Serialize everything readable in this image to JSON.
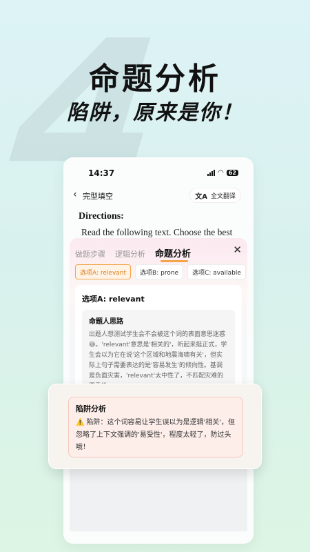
{
  "hero": {
    "background_number": "4",
    "title": "命题分析",
    "subtitle": "陷阱，原来是你！"
  },
  "status_bar": {
    "time": "14:37",
    "battery": "62"
  },
  "nav": {
    "title": "完型填空",
    "translate_label": "全文翻译",
    "translate_icon": "translate-icon"
  },
  "passage": {
    "directions": "Directions:",
    "text": "Read the following text. Choose the best"
  },
  "sheet": {
    "tabs": [
      {
        "label": "做题步骤",
        "active": false
      },
      {
        "label": "逻辑分析",
        "active": false
      },
      {
        "label": "命题分析",
        "active": true
      }
    ],
    "options": [
      {
        "label": "选项A: relevant",
        "active": true
      },
      {
        "label": "选项B: prone",
        "active": false
      },
      {
        "label": "选项C: available",
        "active": false
      },
      {
        "label": "选",
        "active": false
      }
    ],
    "card": {
      "title": "选项A: relevant",
      "section_title": "命题人思路",
      "section_body": "出题人想测试学生会不会被这个词的表面意思迷惑😅。'relevant'意思是'相关的'，听起来挺正式，学生会以为它在说'这个区域和地震海啸有关'，但实际上句子需要表达的是'容易发生'的倾向性。基调是负面灾害，'relevant'太中性了，不匹配灾难的严重性。"
    }
  },
  "popup": {
    "title": "陷阱分析",
    "warning_icon": "⚠️",
    "body": "陷阱：这个词容易让学生误以为是逻辑'相关'，但忽略了上下文强调的'易受性'，程度太轻了，防过头哦！"
  },
  "colors": {
    "accent": "#f4a44a",
    "popup_bg": "#fdeeea"
  }
}
